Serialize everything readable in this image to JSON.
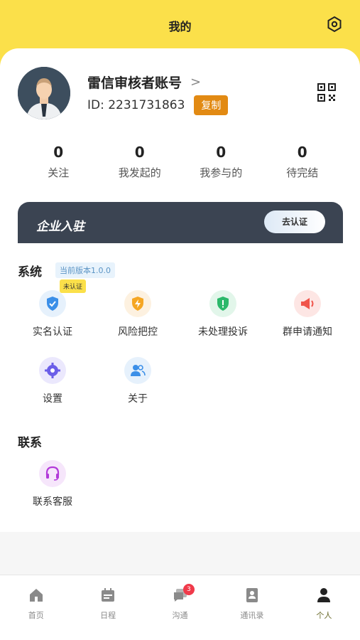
{
  "header": {
    "title": "我的"
  },
  "profile": {
    "name": "雷信审核者账号",
    "chevron": ">",
    "id_text": "ID: 2231731863",
    "copy_label": "复制"
  },
  "stats": [
    {
      "value": "0",
      "label": "关注"
    },
    {
      "value": "0",
      "label": "我发起的"
    },
    {
      "value": "0",
      "label": "我参与的"
    },
    {
      "value": "0",
      "label": "待完结"
    }
  ],
  "banner": {
    "title": "企业入驻",
    "button": "去认证"
  },
  "system": {
    "title": "系统",
    "version": "当前版本1.0.0",
    "unverified_badge": "未认证",
    "items": [
      {
        "label": "实名认证",
        "icon": "shield-check-icon",
        "color": "#3b8fe8"
      },
      {
        "label": "风险把控",
        "icon": "shield-bolt-icon",
        "color": "#f5a623"
      },
      {
        "label": "未处理投诉",
        "icon": "shield-alert-icon",
        "color": "#2cb86a"
      },
      {
        "label": "群申请通知",
        "icon": "megaphone-icon",
        "color": "#f0544a"
      },
      {
        "label": "设置",
        "icon": "gear-icon",
        "color": "#6b5ee8"
      },
      {
        "label": "关于",
        "icon": "users-icon",
        "color": "#3b8fe8"
      }
    ]
  },
  "contact": {
    "title": "联系",
    "items": [
      {
        "label": "联系客服",
        "icon": "headset-icon",
        "color": "#b33ad9"
      }
    ]
  },
  "tabbar": {
    "items": [
      {
        "label": "首页",
        "icon": "home-icon"
      },
      {
        "label": "日程",
        "icon": "calendar-icon"
      },
      {
        "label": "沟通",
        "icon": "chat-icon",
        "badge": "3"
      },
      {
        "label": "通讯录",
        "icon": "contacts-icon"
      },
      {
        "label": "个人",
        "icon": "person-icon",
        "active": true
      }
    ]
  },
  "colors": {
    "accent": "#fbe04a",
    "copy": "#e28a13",
    "banner": "#3b4452"
  }
}
